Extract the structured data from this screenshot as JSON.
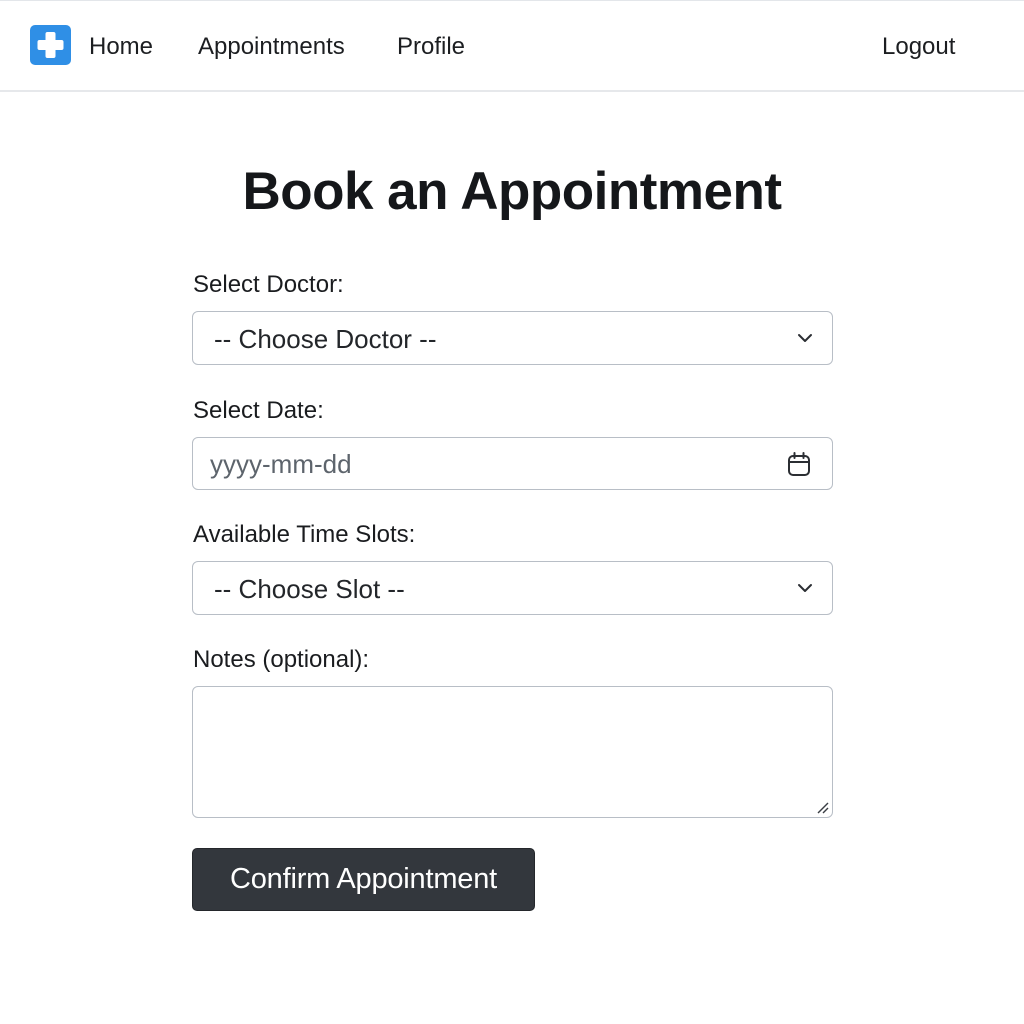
{
  "nav": {
    "brand_icon": "medical-cross-icon",
    "brand_color": "#2f8fe6",
    "links": {
      "home": "Home",
      "appointments": "Appointments",
      "profile": "Profile",
      "logout": "Logout"
    }
  },
  "page": {
    "title": "Book an Appointment"
  },
  "form": {
    "doctor": {
      "label": "Select Doctor:",
      "selected": "-- Choose Doctor --",
      "icon": "chevron-down-icon"
    },
    "date": {
      "label": "Select Date:",
      "placeholder": "yyyy-mm-dd",
      "value": "",
      "icon": "calendar-icon"
    },
    "slot": {
      "label": "Available Time Slots:",
      "selected": "-- Choose Slot --",
      "icon": "chevron-down-icon"
    },
    "notes": {
      "label": "Notes (optional):",
      "value": ""
    },
    "submit_label": "Confirm Appointment",
    "submit_color": "#33373d"
  }
}
